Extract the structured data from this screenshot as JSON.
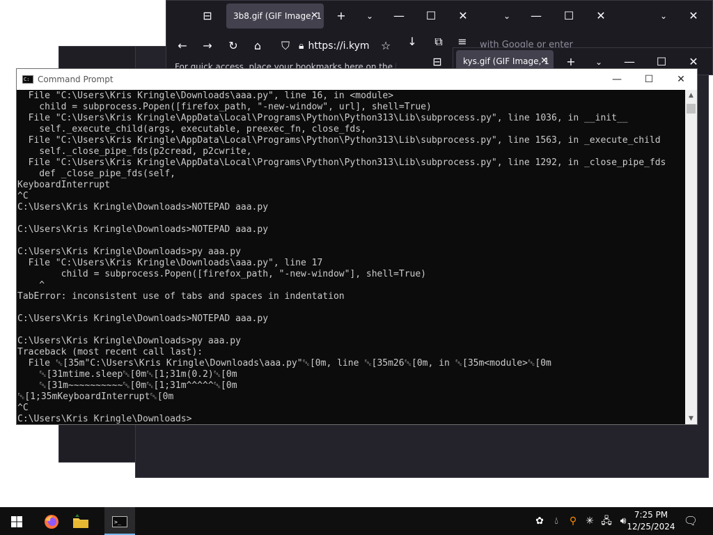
{
  "firefox_main": {
    "tab_label": "3b8.gif (GIF Image, 1",
    "url": "https://i.kym",
    "bookmarks_hint": "For quick access, place your bookmarks here on the bookm",
    "search_hint": "with Google or enter"
  },
  "firefox_second": {
    "tab_label": "kys.gif (GIF Image, 1"
  },
  "cmd": {
    "title": "Command Prompt",
    "lines": [
      "  File \"C:\\Users\\Kris Kringle\\Downloads\\aaa.py\", line 16, in <module>",
      "    child = subprocess.Popen([firefox_path, \"-new-window\", url], shell=True)",
      "  File \"C:\\Users\\Kris Kringle\\AppData\\Local\\Programs\\Python\\Python313\\Lib\\subprocess.py\", line 1036, in __init__",
      "    self._execute_child(args, executable, preexec_fn, close_fds,",
      "  File \"C:\\Users\\Kris Kringle\\AppData\\Local\\Programs\\Python\\Python313\\Lib\\subprocess.py\", line 1563, in _execute_child",
      "    self._close_pipe_fds(p2cread, p2cwrite,",
      "  File \"C:\\Users\\Kris Kringle\\AppData\\Local\\Programs\\Python\\Python313\\Lib\\subprocess.py\", line 1292, in _close_pipe_fds",
      "    def _close_pipe_fds(self,",
      "KeyboardInterrupt",
      "^C",
      "C:\\Users\\Kris Kringle\\Downloads>NOTEPAD aaa.py",
      "",
      "C:\\Users\\Kris Kringle\\Downloads>NOTEPAD aaa.py",
      "",
      "C:\\Users\\Kris Kringle\\Downloads>py aaa.py",
      "  File \"C:\\Users\\Kris Kringle\\Downloads\\aaa.py\", line 17",
      "        child = subprocess.Popen([firefox_path, \"-new-window\"], shell=True)",
      "    ^",
      "TabError: inconsistent use of tabs and spaces in indentation",
      "",
      "C:\\Users\\Kris Kringle\\Downloads>NOTEPAD aaa.py",
      "",
      "C:\\Users\\Kris Kringle\\Downloads>py aaa.py",
      "Traceback (most recent call last):",
      "  File ␛[35m\"C:\\Users\\Kris Kringle\\Downloads\\aaa.py\"␛[0m, line ␛[35m26␛[0m, in ␛[35m<module>␛[0m",
      "    ␛[31mtime.sleep␛[0m␛[1;31m(0.2)␛[0m",
      "    ␛[31m~~~~~~~~~~␛[0m␛[1;31m^^^^^␛[0m",
      "␛[1;35mKeyboardInterrupt␛[0m",
      "^C",
      "C:\\Users\\Kris Kringle\\Downloads>"
    ]
  },
  "taskbar": {
    "time": "7:25 PM",
    "date": "12/25/2024"
  },
  "icons": {
    "start": "windows-logo-icon",
    "firefox": "firefox-icon",
    "explorer": "file-explorer-icon",
    "cmd": "command-prompt-icon"
  }
}
